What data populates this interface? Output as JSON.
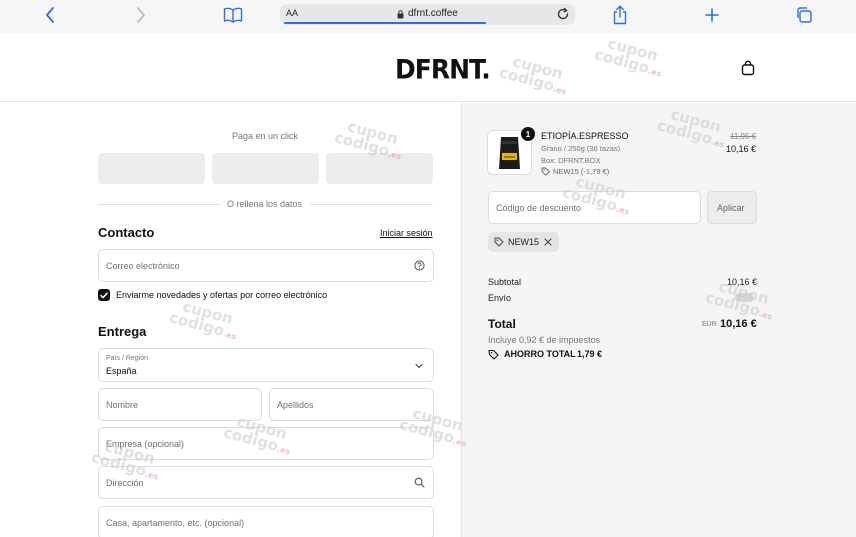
{
  "browser": {
    "aa_label": "AA",
    "url": "dfrnt.coffee"
  },
  "store": {
    "logo": "DFRNT."
  },
  "express": {
    "label": "Paga en un click",
    "or_label": "O rellena los datos"
  },
  "contact": {
    "heading": "Contacto",
    "login_link": "Iniciar sesión",
    "email_placeholder": "Correo electrónico",
    "newsletter_label": "Enviarme novedades y ofertas por correo electrónico"
  },
  "delivery": {
    "heading": "Entrega",
    "country_label": "País / Región",
    "country_value": "España",
    "first_name_placeholder": "Nombre",
    "last_name_placeholder": "Apellidos",
    "company_placeholder": "Empresa (opcional)",
    "address_placeholder": "Dirección",
    "apartment_placeholder": "Casa, apartamento, etc. (opcional)"
  },
  "cart": {
    "item": {
      "quantity": "1",
      "name": "ETIOPÍA.ESPRESSO",
      "variant": "Grano / 250g (36 tazas)",
      "box": "Box: DFRNT.BOX",
      "discount": "NEW15 (-1,79 €)",
      "original_price": "11,95 €",
      "price": "10,16 €"
    },
    "discount_placeholder": "Código de descuento",
    "apply_label": "Aplicar",
    "applied_code": "NEW15",
    "subtotal_label": "Subtotal",
    "subtotal_value": "10,16 €",
    "shipping_label": "Envío",
    "total_label": "Total",
    "currency": "EUR",
    "total_value": "10,16 €",
    "taxes_note": "Incluye 0,92 € de impuestos",
    "savings_label": "AHORRO TOTAL",
    "savings_value": "1,79 €"
  },
  "watermark": {
    "line1": "cupon",
    "line2": "codigo",
    "suffix": ".es"
  },
  "colors": {
    "accent": "#111111",
    "link_blue": "#2b6fe8",
    "summary_bg": "#f5f5f5"
  }
}
